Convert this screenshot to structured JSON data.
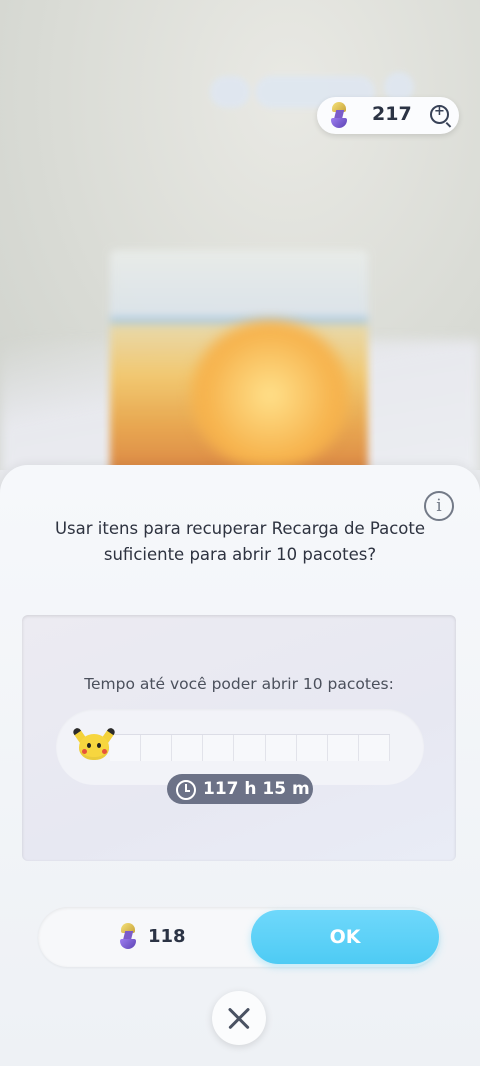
{
  "header": {
    "currency": {
      "icon": "hourglass-icon",
      "value": "217",
      "zoom_icon": "zoom-in-icon"
    }
  },
  "dialog": {
    "info_icon": "info-icon",
    "question_line1": "Usar itens para recuperar Recarga de Pacote",
    "question_line2": "suficiente para abrir 10 pacotes?",
    "timer": {
      "title": "Tempo até você poder abrir 10 pacotes:",
      "progress_fraction": 0,
      "segments": 9,
      "mascot_icon": "pikachu-icon",
      "time_icon": "clock-icon",
      "time_remaining": "117 h 15 m"
    },
    "cost": {
      "icon": "hourglass-icon",
      "value": "118"
    },
    "ok_label": "OK",
    "close_icon": "close-icon"
  },
  "colors": {
    "accent_button": "#4ecbf4",
    "badge_bg": "#6c7287",
    "progress_fill": "#f7d247"
  }
}
